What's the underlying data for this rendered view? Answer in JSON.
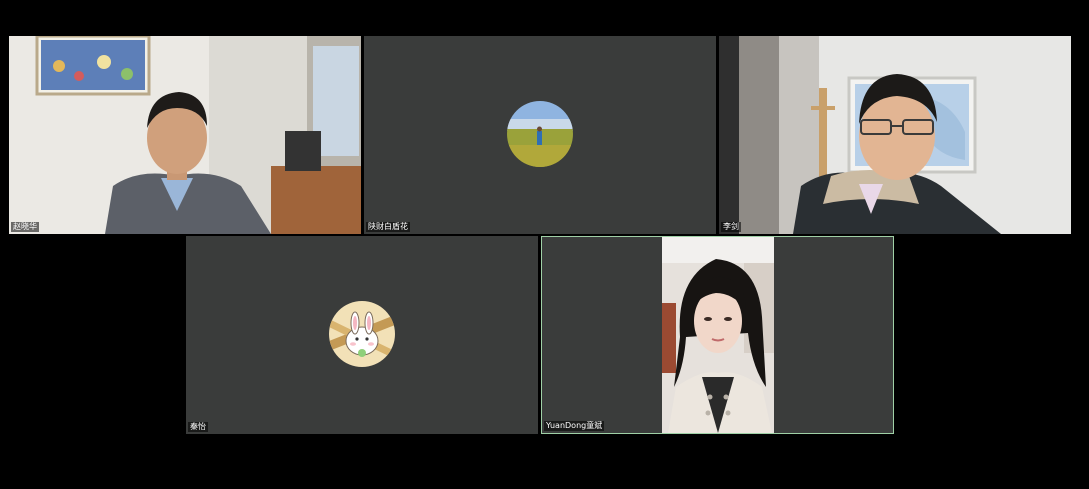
{
  "participants": [
    {
      "name": "赵晓华",
      "video": "camera",
      "active": false
    },
    {
      "name": "陕财白盾花",
      "video": "avatar",
      "avatar_icon": "landscape-photo-avatar",
      "active": false
    },
    {
      "name": "李剑",
      "video": "camera",
      "active": false
    },
    {
      "name": "秦怡",
      "video": "avatar",
      "avatar_icon": "bunny-avatar",
      "active": false
    },
    {
      "name": "YuanDong童斌",
      "video": "camera",
      "active": true
    }
  ],
  "colors": {
    "background": "#000000",
    "tile_background": "#3a3c3b",
    "active_speaker_border": "#9fd0a6"
  }
}
